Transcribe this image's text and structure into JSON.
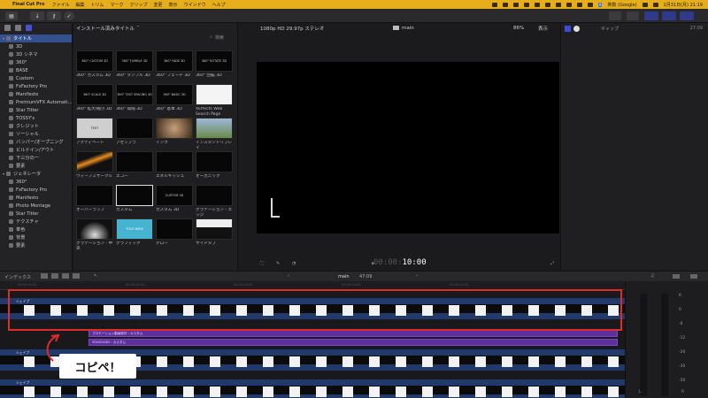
{
  "menubar": {
    "app": "Final Cut Pro",
    "items": [
      "ファイル",
      "編集",
      "トリム",
      "マーク",
      "クリップ",
      "変更",
      "表示",
      "ウインドウ",
      "ヘルプ"
    ],
    "ime": "A",
    "ime_label": "英数 (Google)",
    "clock": "1月31日(月) 21:19"
  },
  "library": {
    "tree": [
      {
        "label": "タイトル",
        "level": 0,
        "open": true,
        "selected": true
      },
      {
        "label": "3D",
        "level": 1
      },
      {
        "label": "3D シネマ",
        "level": 1
      },
      {
        "label": "360°",
        "level": 1
      },
      {
        "label": "BASE",
        "level": 1
      },
      {
        "label": "Custom",
        "level": 1
      },
      {
        "label": "FxFactory Pro",
        "level": 1
      },
      {
        "label": "Manifesto",
        "level": 1
      },
      {
        "label": "PremiumVFX Automati...",
        "level": 1
      },
      {
        "label": "Star Titler",
        "level": 1
      },
      {
        "label": "TOSSY's",
        "level": 1
      },
      {
        "label": "クレジット",
        "level": 1
      },
      {
        "label": "ソーシャル",
        "level": 1
      },
      {
        "label": "バンパー/オープニング",
        "level": 1
      },
      {
        "label": "ビルドイン/アウト",
        "level": 1
      },
      {
        "label": "下三分の一",
        "level": 1
      },
      {
        "label": "要素",
        "level": 1
      },
      {
        "label": "ジェネレータ",
        "level": 0,
        "open": true
      },
      {
        "label": "360°",
        "level": 1
      },
      {
        "label": "FxFactory Pro",
        "level": 1
      },
      {
        "label": "Manifesto",
        "level": 1
      },
      {
        "label": "Photo Montage",
        "level": 1
      },
      {
        "label": "Star Titler",
        "level": 1
      },
      {
        "label": "テクスチャ",
        "level": 1
      },
      {
        "label": "単色",
        "level": 1
      },
      {
        "label": "背景",
        "level": 1
      },
      {
        "label": "要素",
        "level": 1
      }
    ]
  },
  "browser": {
    "title": "インストール済みタイトル",
    "search_placeholder": "検索",
    "items": [
      {
        "thumb": "360° CUSTOM 3D",
        "caption": "360° カスタム 3D"
      },
      {
        "thumb": "360° TUMBLE 3D",
        "caption": "360° タンブル 3D"
      },
      {
        "thumb": "360° FADE 3D",
        "caption": "360° フェード 3D"
      },
      {
        "thumb": "360° ROTATE 3D",
        "caption": "360° 回転 3D"
      },
      {
        "thumb": "360° SCALE 3D",
        "caption": "360° 拡大/縮小 3D"
      },
      {
        "thumb": "360° TEXT SPACING 3D",
        "caption": "360° 間隔 3D"
      },
      {
        "thumb": "360° BASIC 3D",
        "caption": "360° 基本 3D"
      },
      {
        "thumb": "",
        "caption": "XEffects Web Search Page"
      },
      {
        "thumb": "TEXT",
        "caption": "アクティベート"
      },
      {
        "thumb": "",
        "caption": "アセンブラ"
      },
      {
        "thumb": "",
        "caption": "インク"
      },
      {
        "thumb": "",
        "caption": "インスタントリプレイ"
      },
      {
        "thumb": "",
        "caption": "ウィーブズサークル"
      },
      {
        "thumb": "",
        "caption": "エコー"
      },
      {
        "thumb": "",
        "caption": "エネルギッシュ"
      },
      {
        "thumb": "",
        "caption": "オーガニック"
      },
      {
        "thumb": "",
        "caption": "オーバーラップ"
      },
      {
        "thumb": "",
        "caption": "カスタム"
      },
      {
        "thumb": "CUSTOM 3D",
        "caption": "カスタム 3D"
      },
      {
        "thumb": "",
        "caption": "グラデーション - エッジ"
      },
      {
        "thumb": "",
        "caption": "グラデーション - 中央"
      },
      {
        "thumb": "TITLE HERE",
        "caption": "グラフィック"
      },
      {
        "thumb": "",
        "caption": "グロー"
      },
      {
        "thumb": "",
        "caption": "サイドタブ"
      }
    ]
  },
  "viewer": {
    "format": "1080p HD 29.97p ステレオ",
    "project": "main",
    "zoom": "86%",
    "view_label": "表示",
    "timecode_dim": "00:00:",
    "timecode": "10:00"
  },
  "inspector": {
    "header": "ギャップ",
    "duration": "27:09"
  },
  "timeline_toolbar": {
    "index": "インデックス",
    "project": "main",
    "duration": "47:09"
  },
  "timeline": {
    "ruler_ticks": [
      "00:00:00:00",
      "00:00:05:00",
      "00:00:10:00",
      "00:00:15:00",
      "00:00:20:00"
    ],
    "tracks": [
      {
        "label": "シェイプ"
      },
      {
        "label": "シェイプ"
      },
      {
        "label": "シェイプ"
      }
    ],
    "purple_titles": [
      "プロモーション動画制作・カスタム",
      "YOUGOOD!・カスタム"
    ]
  },
  "annotation": {
    "text": "コピペ！"
  },
  "meters": {
    "ticks": [
      "6",
      "0",
      "-6",
      "-12",
      "-20",
      "-30",
      "-50"
    ],
    "left": "L",
    "right": "R"
  },
  "colors": {
    "menubar": "#e6ae1a",
    "track": "#22396b",
    "title_clip": "#5d2f9c",
    "highlight": "#e02b2b",
    "selection": "#35508f"
  }
}
